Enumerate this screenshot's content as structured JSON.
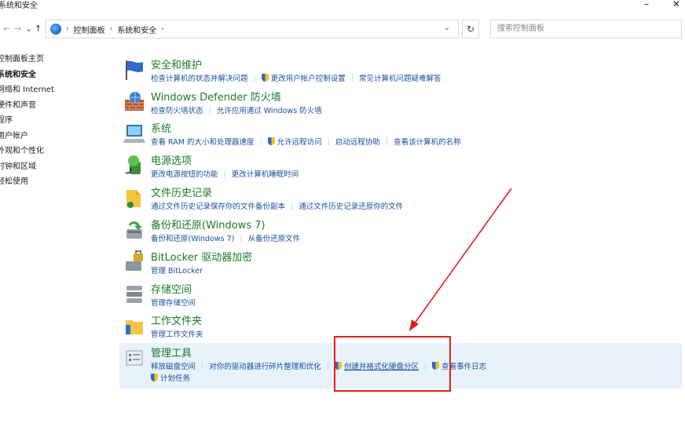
{
  "window": {
    "title": "系统和安全",
    "minimize": "–",
    "close": "✕"
  },
  "nav": {
    "back": "←",
    "forward": "→",
    "recent": "⌄",
    "up": "↑"
  },
  "address": {
    "crumb1": "控制面板",
    "crumb2": "系统和安全",
    "sep": "›",
    "dropdown": "⌄",
    "refresh": "↻"
  },
  "search": {
    "placeholder": "搜索控制面板"
  },
  "sidebar": {
    "items": [
      "控制面板主页",
      "系统和安全",
      "网络和 Internet",
      "硬件和声音",
      "程序",
      "用户帐户",
      "外观和个性化",
      "时钟和区域",
      "轻松使用"
    ]
  },
  "categories": [
    {
      "title": "安全和维护",
      "links": [
        "检查计算机的状态并解决问题",
        "更改用户帐户控制设置",
        "常见计算机问题疑难解答"
      ],
      "icon": "flag-icon"
    },
    {
      "title": "Windows Defender 防火墙",
      "links": [
        "检查防火墙状态",
        "允许应用通过 Windows 防火墙"
      ],
      "icon": "firewall-icon"
    },
    {
      "title": "系统",
      "links": [
        "查看 RAM 的大小和处理器速度",
        "允许远程访问",
        "启动远程协助",
        "查看该计算机的名称"
      ],
      "icon": "computer-icon"
    },
    {
      "title": "电源选项",
      "links": [
        "更改电源按钮的功能",
        "更改计算机睡眠时间"
      ],
      "icon": "power-icon"
    },
    {
      "title": "文件历史记录",
      "links": [
        "通过文件历史记录保存你的文件备份副本",
        "通过文件历史记录还原你的文件"
      ],
      "icon": "file-history-icon"
    },
    {
      "title": "备份和还原(Windows 7)",
      "links": [
        "备份和还原(Windows 7)",
        "从备份还原文件"
      ],
      "icon": "backup-icon"
    },
    {
      "title": "BitLocker 驱动器加密",
      "links": [
        "管理 BitLocker"
      ],
      "icon": "bitlocker-icon"
    },
    {
      "title": "存储空间",
      "links": [
        "管理存储空间"
      ],
      "icon": "storage-icon"
    },
    {
      "title": "工作文件夹",
      "links": [
        "管理工作文件夹"
      ],
      "icon": "work-folders-icon"
    },
    {
      "title": "管理工具",
      "links": [
        "释放磁盘空间",
        "对你的驱动器进行碎片整理和优化",
        "创建并格式化硬盘分区",
        "查看事件日志",
        "计划任务"
      ],
      "icon": "admin-tools-icon"
    }
  ],
  "colors": {
    "title_green": "#1a7a29",
    "link_blue": "#1a4f9c",
    "highlight": "#e8f2fb",
    "annotation_red": "#e0201a"
  }
}
